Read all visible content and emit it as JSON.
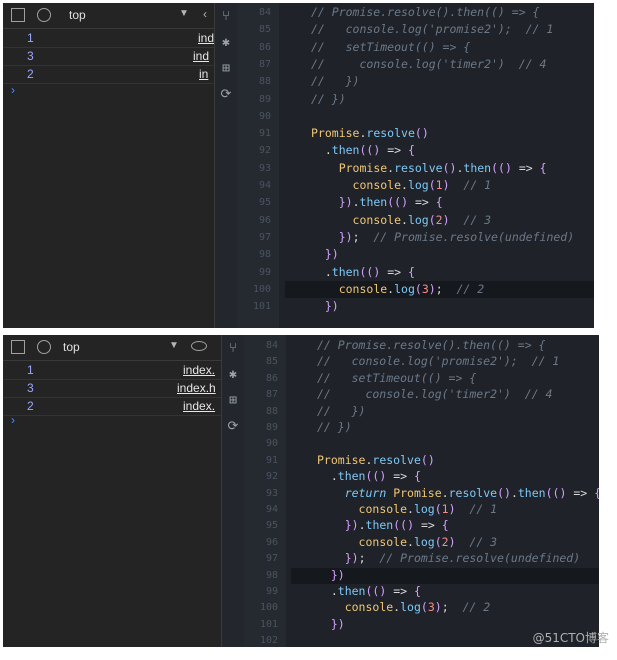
{
  "top_panel": {
    "console": {
      "context": "top",
      "rows": [
        {
          "n": "1",
          "src": "ind"
        },
        {
          "n": "3",
          "src": "ind"
        },
        {
          "n": "2",
          "src": "in"
        }
      ],
      "prompt": "›"
    },
    "line_numbers": [
      "84",
      "85",
      "86",
      "87",
      "88",
      "89",
      "90",
      "91",
      "92",
      "93",
      "94",
      "95",
      "96",
      "97",
      "98",
      "99",
      "100",
      "101"
    ],
    "code_lines": [
      "// Promise.resolve().then(() => {",
      "//   console.log('promise2');  // 1",
      "//   setTimeout(() => {",
      "//     console.log('timer2')  // 4",
      "//   })",
      "// })",
      "",
      "Promise.resolve()",
      "  .then(() => {",
      "    Promise.resolve().then(() => {",
      "      console.log(1)  // 1",
      "    }).then(() => {",
      "      console.log(2)  // 3",
      "    });  // Promise.resolve(undefined)",
      "  })",
      "  .then(() => {",
      "    console.log(3);  // 2",
      "  })"
    ]
  },
  "bottom_panel": {
    "console": {
      "context": "top",
      "rows": [
        {
          "n": "1",
          "src": "index."
        },
        {
          "n": "3",
          "src": "index.h"
        },
        {
          "n": "2",
          "src": "index."
        }
      ],
      "prompt": "›"
    },
    "line_numbers": [
      "84",
      "85",
      "86",
      "87",
      "88",
      "89",
      "90",
      "91",
      "92",
      "93",
      "94",
      "95",
      "96",
      "97",
      "98",
      "99",
      "100",
      "101",
      "102"
    ],
    "code_lines": [
      "// Promise.resolve().then(() => {",
      "//   console.log('promise2');  // 1",
      "//   setTimeout(() => {",
      "//     console.log('timer2')  // 4",
      "//   })",
      "// })",
      "",
      "Promise.resolve()",
      "  .then(() => {",
      "    return Promise.resolve().then(() => {",
      "      console.log(1)  // 1",
      "    }).then(() => {",
      "      console.log(2)  // 3",
      "    });  // Promise.resolve(undefined)",
      "  })",
      "  .then(() => {",
      "    console.log(3);  // 2",
      "  })",
      ""
    ]
  },
  "watermark": "@51CTO博客"
}
